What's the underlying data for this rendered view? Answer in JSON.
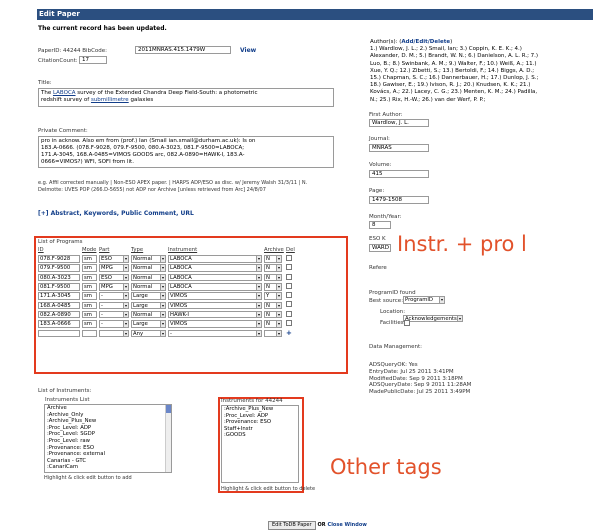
{
  "header": {
    "title": "Edit Paper"
  },
  "status_message": "The current record has been updated.",
  "paper": {
    "paper_id_label": "PaperID: 44244 BibCode:",
    "bibcode_value": "2011MNRAS.415.1479W",
    "view_link": "View",
    "citation_label": "CitationCount:",
    "citation_value": "17",
    "title_label": "Title:",
    "title_line1_a": "The ",
    "title_line1_u": "LABOCA",
    "title_line1_b": " survey of the Extended Chandra Deep Field-South: a photometric",
    "title_line2_a": "redshift survey of ",
    "title_line2_u": "submillimetre",
    "title_line2_b": " galaxies",
    "private_label": "Private Comment:",
    "private_lines": [
      "pro in acknow. Also em from (prof.) Ian (Smail ian.smail@durham.ac.uk): Is on",
      "183.A-0666. (078.F-9028, 079.F-9500, 080.A-3023, 081.F-9500=LABOCA;",
      "171.A-3045, 168.A-0485=VIMOS GOODS arc, 082.A-0890=HAWK-I, 183.A-",
      "0666=VIMOS?) WFI, SOFI from lit."
    ],
    "note_line1": "e.g. Affil corrected manually | Non-ESO APEX paper. | HARPS ADP/ESO as disc. w/ Jeremy Walsh 31/3/11 | N.",
    "note_line2": "Delmotte: UVES POP (266.D-5655) not ADP nor Archive [unless retrieved from Arc] 24/8/07",
    "abstract_link": "[+] Abstract, Keywords, Public Comment, URL"
  },
  "programs": {
    "title": "List of Programs",
    "headers": {
      "id": "ID",
      "mode": "Mode",
      "part": "Part",
      "type": "Type",
      "instrument": "Instrument",
      "archive": "Archive",
      "del": "Del"
    },
    "rows": [
      {
        "id": "078.F-9028",
        "mode": "sm",
        "part": "ESO",
        "type": "Normal",
        "instrument": "LABOCA",
        "archive": "N"
      },
      {
        "id": "079.F-9500",
        "mode": "sm",
        "part": "MPG",
        "type": "Normal",
        "instrument": "LABOCA",
        "archive": "N"
      },
      {
        "id": "080.A-3023",
        "mode": "sm",
        "part": "ESO",
        "type": "Normal",
        "instrument": "LABOCA",
        "archive": "N"
      },
      {
        "id": "081.F-9500",
        "mode": "sm",
        "part": "MPG",
        "type": "Normal",
        "instrument": "LABOCA",
        "archive": "N"
      },
      {
        "id": "171.A-3045",
        "mode": "sm",
        "part": "-",
        "type": "Large",
        "instrument": "VIMOS",
        "archive": "Y"
      },
      {
        "id": "168.A-0485",
        "mode": "sm",
        "part": "-",
        "type": "Large",
        "instrument": "VIMOS",
        "archive": "N"
      },
      {
        "id": "082.A-0890",
        "mode": "sm",
        "part": "-",
        "type": "Normal",
        "instrument": "HAWK-I",
        "archive": "N"
      },
      {
        "id": "183.A-0666",
        "mode": "sm",
        "part": "-",
        "type": "Large",
        "instrument": "VIMOS",
        "archive": "N"
      },
      {
        "id": "",
        "mode": "",
        "part": "",
        "type": "Any",
        "instrument": "-",
        "archive": ""
      }
    ],
    "add_symbol": "+"
  },
  "instruments": {
    "section_label": "List of Instruments:",
    "list_title": "Instruments List",
    "list_items": [
      "Archive",
      ":Archive_Only",
      ":Archive_Plus_New",
      ":Proc_Level: ADP",
      ":Proc_Level: SGDP",
      ":Proc_Level: raw",
      ":Provenance: ESO",
      ":Provenance: external",
      "Canarias - GTC",
      ":CanariCam"
    ],
    "list_hint": "Highlight & click edit button to add",
    "for_title": "Instruments for 44244",
    "for_items": [
      ":Archive_Plus_New",
      ":Proc_Level: ADP",
      ":Provenance: ESO",
      "Staff+Instr",
      ":GOODS"
    ],
    "for_hint": "Highlight & click edit button to delete"
  },
  "right": {
    "authors_label": "Author(s): (",
    "authors_link": "Add/Edit/Delete",
    "authors_label_end": ")",
    "authors_lines": [
      "1.) Wardlow, J. L.; 2.) Smail, Ian; 3.) Coppin, K. E. K.; 4.)",
      "Alexander, D. M.; 5.) Brandt, W. N.; 6.) Danielson, A. L. R.; 7.)",
      "Luo, B.; 8.) Swinbank, A. M.; 9.) Walter, F.; 10.) Weiß, A.; 11.)",
      "Xue, Y. Q.; 12.) Zibetti, S.; 13.) Bertoldi, F.; 14.) Biggs, A. D.;",
      "15.) Chapman, S. C.; 16.) Dannerbauer, H.; 17.) Dunlop, J. S.;",
      "18.) Gawiser, E.; 19.) Ivison, R. J.; 20.) Knudsen, K. K.; 21.)",
      "Kovács, A.; 22.) Lacey, C. G.; 23.) Menten, K. M.; 24.) Padilla,",
      "N.; 25.) Rix, H.-W.; 26.) van der Werf, P. P.;"
    ],
    "first_author_label": "First Author:",
    "first_author_value": "Wardlow, J. L.",
    "journal_label": "Journal:",
    "journal_value": "MNRAS",
    "volume_label": "Volume:",
    "volume_value": "415",
    "page_label": "Page:",
    "page_value": "1479-1508",
    "month_label": "Month/Year:",
    "month_value": "8",
    "eso_label": "ESO K",
    "eso_value": "WARD",
    "refer_label": "Refere",
    "progid_label": "ProgramID found",
    "best_source_label": "Best source:",
    "best_source_value": "ProgramID",
    "location_label": "Location:",
    "location_value": "Acknowledgements",
    "facilities_label": "Facilities:",
    "dm_label": "Data Management:",
    "dm_lines": [
      "ADSQueryOK: Yes",
      "EntryDate: Jul 25 2011 3:41PM",
      "ModifiedDate: Sep 9 2011 3:18PM",
      "ADSQueryDate: Sep 9 2011 11:28AM",
      "MadePublicDate: Jul 25 2011 3:49PM"
    ]
  },
  "footer": {
    "edit_button": "Edit ToDB Paper",
    "or": "OR",
    "close_link": "Close Window"
  },
  "annotations": {
    "instr_pro": "Instr. + pro l",
    "other_tags": "Other tags"
  },
  "colors": {
    "header": "#2b4f80",
    "annotation": "#e33a1e",
    "link": "#123e8a"
  }
}
